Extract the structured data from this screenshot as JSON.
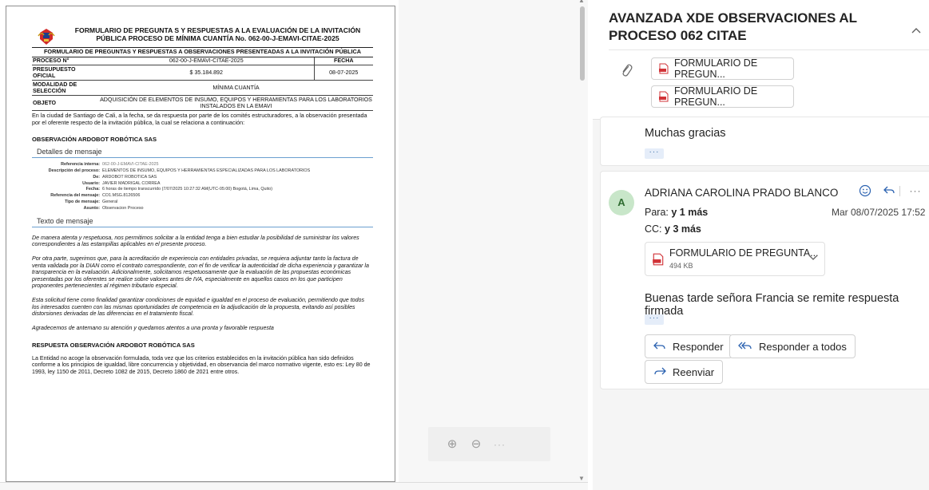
{
  "document": {
    "title_line1": "FORMULARIO DE PREGUNTA S Y RESPUESTAS A LA EVALUACIÓN DE LA INVITACIÓN",
    "title_line2": "PÚBLICA PROCESO DE MÍNIMA CUANTÍA No. 062-00-J-EMAVI-CITAE-2025",
    "subtitle": "FORMULARIO DE PREGUNTAS Y RESPUESTAS A OBSERVACIONES PRESENTEADAS A LA INVITACIÓN PÚBLICA",
    "rows": {
      "proceso_label": "PROCESO N°",
      "proceso_value": "062-00-J-EMAVI-CITAE-2025",
      "fecha_label": "FECHA",
      "presupuesto_label": "PRESUPUESTO OFICIAL",
      "presupuesto_value": "$ 35.184.892",
      "fecha_value": "08-07-2025",
      "modalidad_label": "MODALIDAD DE SELECCIÓN",
      "modalidad_value": "MÍNIMA CUANTÍA",
      "objeto_label": "OBJETO",
      "objeto_value": "ADQUISICIÓN DE ELEMENTOS DE INSUMO, EQUIPOS Y HERRAMIENTAS PARA LOS LABORATORIOS INSTALADOS EN LA EMAVI"
    },
    "intro": "En la ciudad de Santiago de Cali, a la fecha, se da respuesta por parte de los comités estructuradores, a la observación presentada por el oferente respecto de la invitación pública, la cual se relaciona a continuación:",
    "section_observacion": "OBSERVACIÓN ARDOBOT ROBÓTICA SAS",
    "detalles_heading": "Detalles de mensaje",
    "details": [
      {
        "k": "Referencia interna:",
        "v": "062-00-J-EMAVI-CITAE-2025",
        "muted": true
      },
      {
        "k": "Descripción del proceso:",
        "v": "ELEMENTOS DE INSUMO, EQUIPOS Y HERRAMIENTAS ESPECIALIZADAS PARA LOS LABORATORIOS",
        "muted": false
      },
      {
        "k": "De:",
        "v": "ARDOBOT ROBOTICA SAS",
        "muted": false
      },
      {
        "k": "Usuario:",
        "v": "JAVIER MADRIGAL CORREA",
        "muted": false
      },
      {
        "k": "Fecha:",
        "v": "6 horas de tiempo transcurrido (7/07/2025 10:27:32 AM(UTC-05:00) Bogotá, Lima, Quito)",
        "muted": false
      },
      {
        "k": "Referencia del mensaje:",
        "v": "CO1.MSG.8126506",
        "muted": false
      },
      {
        "k": "Tipo de mensaje:",
        "v": "General",
        "muted": false
      },
      {
        "k": "Asunto:",
        "v": "Observacion Proceso",
        "muted": false
      }
    ],
    "texto_heading": "Texto de mensaje",
    "paragraphs": [
      "De manera atenta y respetuosa, nos permitimos solicitar a la entidad tenga a bien estudiar la posibilidad de suministrar los valores correspondientes a las estampillas aplicables en el presente proceso.",
      "Por otra parte, sugerimos que, para la acreditación de experiencia con entidades privadas, se requiera adjuntar tanto la factura de venta validada por la DIAN como el contrato correspondiente, con el fin de verificar la autenticidad de dicha experiencia y garantizar la transparencia en la evaluación. Adicionalmente, solicitamos respetuosamente que la evaluación de las propuestas económicas presentadas por los oferentes se realice sobre valores antes de IVA, especialmente en aquellos casos en los que participen proponentes pertenecientes al régimen tributario especial.",
      "Esta solicitud tiene como finalidad garantizar condiciones de equidad e igualdad en el proceso de evaluación, permitiendo que todos los interesados cuenten con las mismas oportunidades de competencia en la adjudicación de la propuesta, evitando así posibles distorsiones derivadas de las diferencias en el tratamiento fiscal.",
      "Agradecemos de antemano su atención y quedamos atentos a una pronta y favorable respuesta"
    ],
    "section_respuesta": "RESPUESTA OBSERVACIÓN ARDOBOT ROBÓTICA SAS",
    "respuesta_text": "La Entidad no acoge la observación formulada, toda vez que los criterios establecidos en la invitación pública han sido definidos conforme a los principios de igualdad, libre concurrencia y objetividad, en observancia del marco normativo vigente, esto es: Ley 80 de 1993, ley 1150 de 2011, Decreto 1082 de 2015, Decreto 1860 de 2021 entre otros."
  },
  "zoom_bar": {
    "zoom_in": "⊕",
    "zoom_out": "⊖",
    "more": "···"
  },
  "thread": {
    "subject": "AVANZADA XDE OBSERVACIONES AL PROCESO 062 CITAE",
    "attachments": [
      {
        "name": "FORMULARIO DE PREGUN..."
      },
      {
        "name": "FORMULARIO DE PREGUN..."
      }
    ]
  },
  "message1": {
    "body": "Muchas gracias",
    "more": "···"
  },
  "message2": {
    "avatar_initial": "A",
    "sender": "ADRIANA CAROLINA PRADO BLANCO",
    "to_label": "Para:",
    "to_value": "y 1 más",
    "cc_label": "CC:",
    "cc_value": "y 3 más",
    "date": "Mar 08/07/2025 17:52",
    "attachment_name": "FORMULARIO DE PREGUNTA...",
    "attachment_size": "494 KB",
    "body": "Buenas tarde señora Francia se remite respuesta firmada",
    "more": "···",
    "reply_label": "Responder",
    "reply_all_label": "Responder a todos",
    "forward_label": "Reenviar"
  },
  "icons": {
    "collapse": "chevron-up-icon",
    "emoji": "smile-icon",
    "reply": "reply-icon",
    "more": "more-icon",
    "attachment": "paperclip-icon",
    "pdf": "pdf-icon"
  }
}
